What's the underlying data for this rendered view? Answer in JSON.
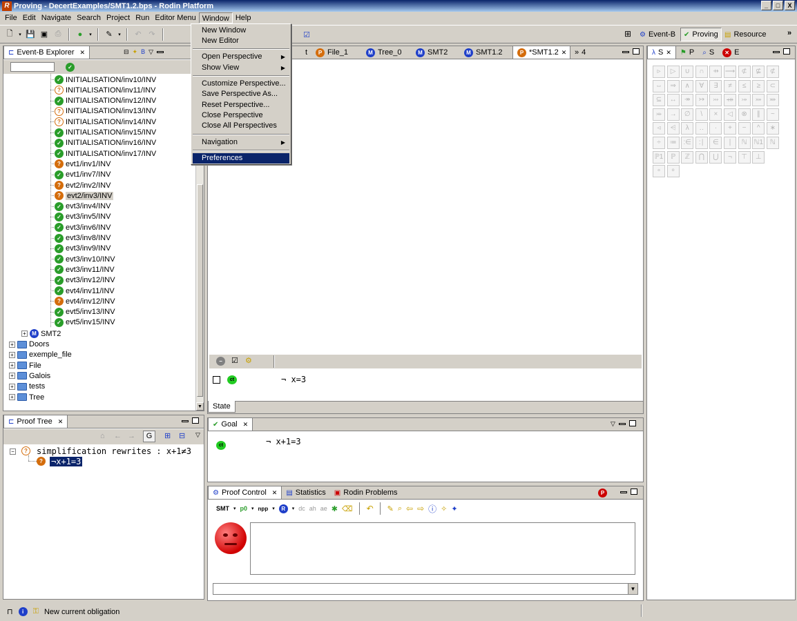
{
  "window": {
    "title": "Proving - DecertExamples/SMT1.2.bps - Rodin Platform",
    "app_icon": "R",
    "min": "_",
    "max": "□",
    "close": "X"
  },
  "menubar": {
    "items": [
      "File",
      "Edit",
      "Navigate",
      "Search",
      "Project",
      "Run",
      "Editor Menu",
      "Window",
      "Help"
    ]
  },
  "window_menu": {
    "items": [
      "New Window",
      "New Editor",
      "Open Perspective",
      "Show View",
      "Customize Perspective...",
      "Save Perspective As...",
      "Reset Perspective...",
      "Close Perspective",
      "Close All Perspectives",
      "Navigation",
      "Preferences"
    ],
    "selected": "Preferences"
  },
  "perspectives": {
    "items": [
      "Event-B",
      "Proving",
      "Resource"
    ],
    "active": "Proving",
    "more": "»"
  },
  "explorer": {
    "tab_label": "Event-B Explorer",
    "obligations": [
      {
        "label": "INITIALISATION/inv10/INV",
        "status": "green"
      },
      {
        "label": "INITIALISATION/inv11/INV",
        "status": "question"
      },
      {
        "label": "INITIALISATION/inv12/INV",
        "status": "green"
      },
      {
        "label": "INITIALISATION/inv13/INV",
        "status": "question"
      },
      {
        "label": "INITIALISATION/inv14/INV",
        "status": "question"
      },
      {
        "label": "INITIALISATION/inv15/INV",
        "status": "green"
      },
      {
        "label": "INITIALISATION/inv16/INV",
        "status": "green"
      },
      {
        "label": "INITIALISATION/inv17/INV",
        "status": "green"
      },
      {
        "label": "evt1/inv1/INV",
        "status": "orange"
      },
      {
        "label": "evt1/inv7/INV",
        "status": "green"
      },
      {
        "label": "evt2/inv2/INV",
        "status": "orange"
      },
      {
        "label": "evt2/inv3/INV",
        "status": "orange"
      },
      {
        "label": "evt3/inv4/INV",
        "status": "green"
      },
      {
        "label": "evt3/inv5/INV",
        "status": "green"
      },
      {
        "label": "evt3/inv6/INV",
        "status": "green"
      },
      {
        "label": "evt3/inv8/INV",
        "status": "green"
      },
      {
        "label": "evt3/inv9/INV",
        "status": "green"
      },
      {
        "label": "evt3/inv10/INV",
        "status": "green"
      },
      {
        "label": "evt3/inv11/INV",
        "status": "green"
      },
      {
        "label": "evt3/inv12/INV",
        "status": "green"
      },
      {
        "label": "evt4/inv11/INV",
        "status": "green"
      },
      {
        "label": "evt4/inv12/INV",
        "status": "orange"
      },
      {
        "label": "evt5/inv13/INV",
        "status": "green"
      },
      {
        "label": "evt5/inv15/INV",
        "status": "green"
      }
    ],
    "selected_obligation": "evt2/inv3/INV",
    "machine": "SMT2",
    "projects": [
      "Doors",
      "exemple_file",
      "File",
      "Galois",
      "tests",
      "Tree"
    ]
  },
  "editor_tabs": {
    "items": [
      {
        "label": "File_1",
        "icon": "P"
      },
      {
        "label": "Tree_0",
        "icon": "M"
      },
      {
        "label": "SMT2",
        "icon": "M"
      },
      {
        "label": "SMT1.2",
        "icon": "M"
      },
      {
        "label": "*SMT1.2",
        "icon": "P"
      }
    ],
    "partial_label": "t",
    "overflow": "4"
  },
  "state_view": {
    "tab_label": "State",
    "hypothesis": "¬ x=3",
    "badge": "ct"
  },
  "goal_view": {
    "tab_label": "Goal",
    "goal": "¬ x+1=3",
    "badge": "ct"
  },
  "proof_tree": {
    "tab_label": "Proof Tree",
    "root": "simplification rewrites : x+1≠3",
    "child": "¬x+1=3",
    "g_button": "G"
  },
  "proof_control": {
    "tabs": [
      "Proof Control",
      "Statistics",
      "Rodin Problems"
    ],
    "toolbar_labels": [
      "SMT",
      "p0",
      "npp",
      "R",
      "dc",
      "ah",
      "ae"
    ]
  },
  "symbols": {
    "tab_labels": [
      "S",
      "P",
      "S",
      "E"
    ],
    "rows": [
      [
        "▹",
        "▷",
        "∪",
        "∩",
        "⇸",
        "⟶",
        "⊄",
        "⊈",
        "⊄"
      ],
      [
        "⇔",
        "⇒",
        "∧",
        "∀",
        "∃",
        "≠",
        "≤",
        "≥",
        "⊂"
      ],
      [
        "⊆",
        "↔",
        "↠",
        "↣",
        "⤔",
        "⤀",
        "⤖",
        "⤗",
        "⤘"
      ],
      [
        "⤕",
        "→",
        "∅",
        "\\",
        "×",
        "◁",
        "⊗",
        "∥",
        "~"
      ],
      [
        "◃",
        "⩤",
        "λ",
        "‥",
        "·",
        "+",
        "−",
        "^",
        "∗"
      ],
      [
        "÷",
        "≔",
        ":∈",
        ":∣",
        "∈",
        "∣",
        "ℕ",
        "ℕ1",
        "ℕ"
      ],
      [
        "ℙ1",
        "ℙ",
        "ℤ",
        "⋂",
        "⋃",
        "¬",
        "⊤",
        "⊥"
      ],
      [
        "∘",
        "⚬"
      ]
    ]
  },
  "statusbar": {
    "message": "New current obligation"
  },
  "colors": {
    "title_bar_start": "#0a246a",
    "title_bar_end": "#a6caf0",
    "selection": "#0a246a",
    "proved": "#2a9d2a",
    "pending": "#d46d0c"
  }
}
